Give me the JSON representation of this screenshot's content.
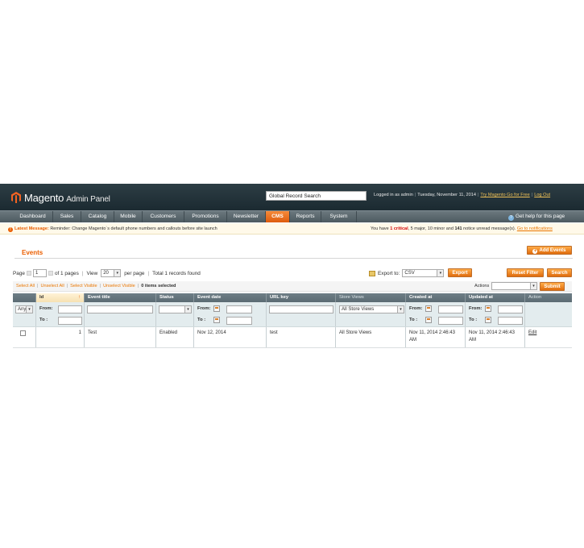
{
  "header": {
    "brand": "Magento",
    "brand_sub": "Admin Panel",
    "search_value": "Global Record Search",
    "logged_in": "Logged in as admin",
    "date": "Tuesday, November 11, 2014",
    "try_link": "Try Magento Go for Free",
    "logout": "Log Out"
  },
  "nav": {
    "items": [
      "Dashboard",
      "Sales",
      "Catalog",
      "Mobile",
      "Customers",
      "Promotions",
      "Newsletter",
      "CMS",
      "Reports",
      "System"
    ],
    "active": "CMS",
    "help": "Get help for this page"
  },
  "message": {
    "label": "Latest Message:",
    "text": "Reminder: Change Magento`s default phone numbers and callouts before site launch",
    "right_prefix": "You have",
    "critical": "1 critical",
    "major": "5 major",
    "minor": "10 minor",
    "and": "and",
    "notice": "141",
    "notice_suffix": "notice unread message(s).",
    "goto": "Go to notifications"
  },
  "page": {
    "title": "Events",
    "add_button": "Add Events",
    "reset_button": "Reset Filter",
    "search_button": "Search",
    "export_button": "Export",
    "submit_button": "Submit"
  },
  "pager": {
    "page_label": "Page",
    "page_value": "1",
    "of_pages": "of 1 pages",
    "view_label": "View",
    "per_page_value": "20",
    "per_page_label": "per page",
    "total": "Total 1 records found",
    "export_label": "Export to:",
    "export_value": "CSV"
  },
  "massaction": {
    "select_all": "Select All",
    "unselect_all": "Unselect All",
    "select_visible": "Select Visible",
    "unselect_visible": "Unselect Visible",
    "selected": "0 items selected",
    "actions_label": "Actions"
  },
  "grid": {
    "columns": [
      "Id",
      "Event title",
      "Status",
      "Event date",
      "URL key",
      "Store Views",
      "Created at",
      "Updated at",
      "Action"
    ],
    "filter": {
      "any": "Any",
      "from": "From:",
      "to": "To :",
      "store_views": "All Store Views"
    },
    "rows": [
      {
        "id": "1",
        "title": "Test",
        "status": "Enabled",
        "event_date": "Nov 12, 2014",
        "url_key": "test",
        "store_views": "All Store Views",
        "created_line1": "Nov 11, 2014 2:46:43",
        "created_line2": "AM",
        "updated_line1": "Nov 11, 2014 2:46:43",
        "updated_line2": "AM",
        "action": "Edit"
      }
    ]
  },
  "colors": {
    "accent": "#eb5e00",
    "header_bg": "#253338",
    "nav_bg": "#5d6a70",
    "grid_header": "#66767e",
    "filter_bg": "#e3ecee"
  }
}
